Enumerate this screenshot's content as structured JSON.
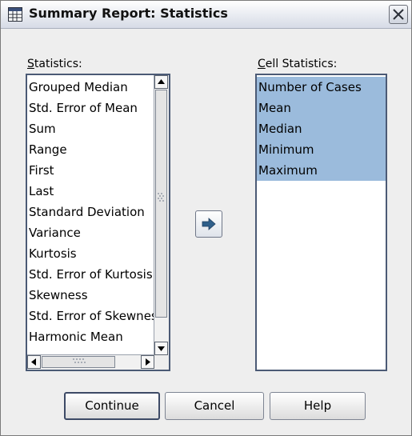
{
  "window": {
    "title": "Summary Report: Statistics",
    "app_icon": "grid-report-icon",
    "close_icon": "close-icon"
  },
  "statistics_list": {
    "label_mnemonic": "S",
    "label_rest": "tatistics:",
    "items": [
      "Grouped Median",
      "Std. Error of Mean",
      "Sum",
      "Range",
      "First",
      "Last",
      "Standard Deviation",
      "Variance",
      "Kurtosis",
      "Std. Error of Kurtosis",
      "Skewness",
      "Std. Error of Skewness",
      "Harmonic Mean"
    ]
  },
  "cell_statistics_list": {
    "label_mnemonic": "C",
    "label_rest": "ell Statistics:",
    "items": [
      "Number of Cases",
      "Mean",
      "Median",
      "Minimum",
      "Maximum"
    ],
    "selected_color": "#9bbbdc"
  },
  "move_button": {
    "icon": "arrow-right-icon"
  },
  "buttons": {
    "continue_label": "Continue",
    "cancel_label": "Cancel",
    "help_label": "Help"
  }
}
